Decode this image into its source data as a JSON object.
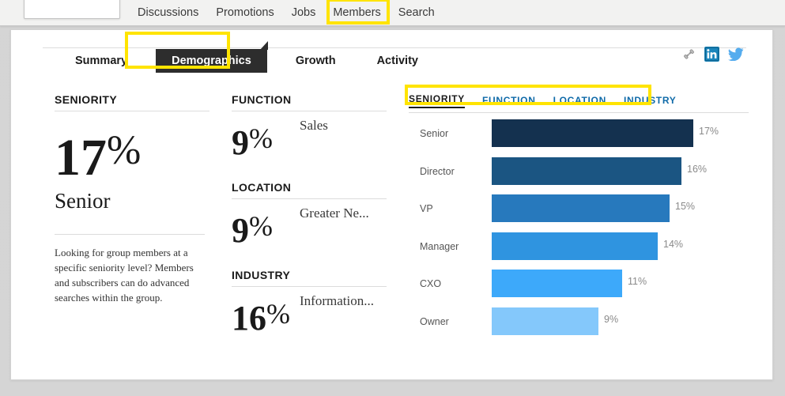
{
  "topnav": {
    "search_placeholder": "",
    "search_value": "",
    "items": [
      {
        "label": "Discussions",
        "highlighted": false
      },
      {
        "label": "Promotions",
        "highlighted": false
      },
      {
        "label": "Jobs",
        "highlighted": false
      },
      {
        "label": "Members",
        "highlighted": true
      },
      {
        "label": "Search",
        "highlighted": false
      }
    ]
  },
  "tabs": [
    {
      "label": "Summary",
      "active": false
    },
    {
      "label": "Demographics",
      "active": true
    },
    {
      "label": "Growth",
      "active": false
    },
    {
      "label": "Activity",
      "active": false
    }
  ],
  "social": [
    {
      "name": "link-icon",
      "label": "Link"
    },
    {
      "name": "linkedin-icon",
      "label": "LinkedIn"
    },
    {
      "name": "twitter-icon",
      "label": "Twitter"
    }
  ],
  "seniority_panel": {
    "heading": "SENIORITY",
    "value": "17",
    "percent_sign": "%",
    "label": "Senior",
    "help_text": "Looking for group members at a specific seniority level? Members and subscribers can do advanced searches within the group."
  },
  "stat_blocks": [
    {
      "heading": "FUNCTION",
      "value": "9",
      "percent_sign": "%",
      "label": "Sales"
    },
    {
      "heading": "LOCATION",
      "value": "9",
      "percent_sign": "%",
      "label": "Greater Ne..."
    },
    {
      "heading": "INDUSTRY",
      "value": "16",
      "percent_sign": "%",
      "label": "Information..."
    }
  ],
  "chart_subtabs": [
    {
      "label": "SENIORITY",
      "active": true
    },
    {
      "label": "FUNCTION",
      "active": false
    },
    {
      "label": "LOCATION",
      "active": false
    },
    {
      "label": "INDUSTRY",
      "active": false
    }
  ],
  "colors": {
    "highlight": "#ffe400",
    "active_tab_bg": "#2d2d2d",
    "link_blue": "#0f6aa8",
    "linkedin_blue": "#1b86bc",
    "twitter_blue": "#55acee"
  },
  "chart_data": {
    "type": "bar",
    "orientation": "horizontal",
    "title": "SENIORITY",
    "xlabel": "",
    "ylabel": "",
    "categories": [
      "Senior",
      "Director",
      "VP",
      "Manager",
      "CXO",
      "Owner"
    ],
    "values": [
      17,
      16,
      15,
      14,
      11,
      9
    ],
    "value_labels": [
      "17%",
      "16%",
      "15%",
      "14%",
      "11%",
      "9%"
    ],
    "colors": [
      "#14314f",
      "#1b5582",
      "#2779bd",
      "#2f94e0",
      "#3da9fa",
      "#84c8fb"
    ],
    "xlim": [
      0,
      18.8
    ],
    "grid": false,
    "legend": false
  }
}
